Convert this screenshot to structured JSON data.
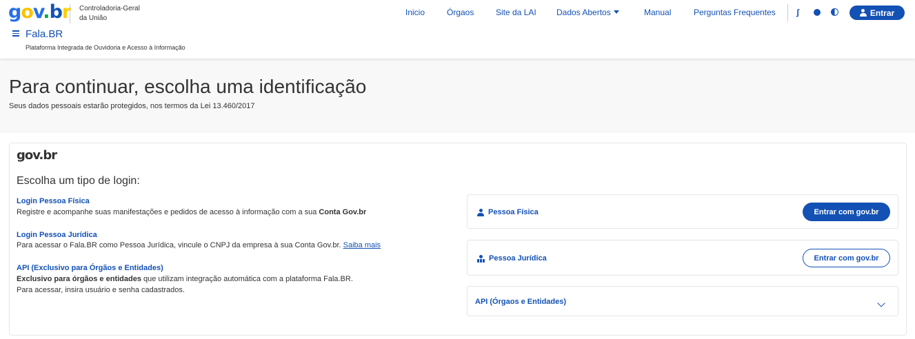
{
  "brand": {
    "logo": "gov.br",
    "org_line1": "Controladoria-Geral",
    "org_line2": "da União",
    "primary_color": "#1351b4",
    "logo_colors": [
      "#2670e8",
      "#f8c300",
      "#00a859",
      "#1351b4"
    ]
  },
  "nav": {
    "items": [
      {
        "label": "Inicio"
      },
      {
        "label": "Órgaos"
      },
      {
        "label": "Site da LAI"
      },
      {
        "label": "Dados Abertos",
        "has_dropdown": true
      },
      {
        "label": "Manual"
      },
      {
        "label": "Perguntas Frequentes"
      }
    ],
    "tools": [
      "accessibility-icon",
      "cookie-icon",
      "contrast-icon"
    ],
    "login_label": "Entrar"
  },
  "app": {
    "title": "Fala.BR",
    "subtitle": "Plataforma Integrada de Ouvidoria e Acesso à Informação"
  },
  "hero": {
    "title": "Para continuar, escolha uma identificação",
    "subtitle": "Seus dados pessoais estarão protegidos, nos termos da Lei 13.460/2017"
  },
  "login": {
    "heading": "Escolha um tipo de login:",
    "options": [
      {
        "title": "Login Pessoa Física",
        "text": "Registre e acompanhe suas manifestações e pedidos de acesso à informação com a sua ",
        "text_bold": "Conta Gov.br"
      },
      {
        "title": "Login Pessoa Jurídica",
        "text": "Para acessar o Fala.BR como Pessoa Jurídica, vincule o CNPJ da empresa à sua Conta Gov.br. ",
        "link": "Saiba mais"
      },
      {
        "title": "API (Exclusivo para Órgãos e Entidades)",
        "text_bold": "Exclusivo para órgãos e entidades",
        "text": " que utilizam integração automática com a plataforma Fala.BR.",
        "text2": "Para acessar, insira usuário e senha cadastrados."
      }
    ],
    "panels": [
      {
        "label": "Pessoa Física",
        "button": "Entrar com gov.br",
        "icon": "user-icon"
      },
      {
        "label": "Pessoa Jurídica",
        "button": "Entrar com gov.br",
        "icon": "users-icon"
      },
      {
        "label": "API (Órgaos e Entidades)",
        "icon": "chevron-down-icon"
      }
    ]
  }
}
